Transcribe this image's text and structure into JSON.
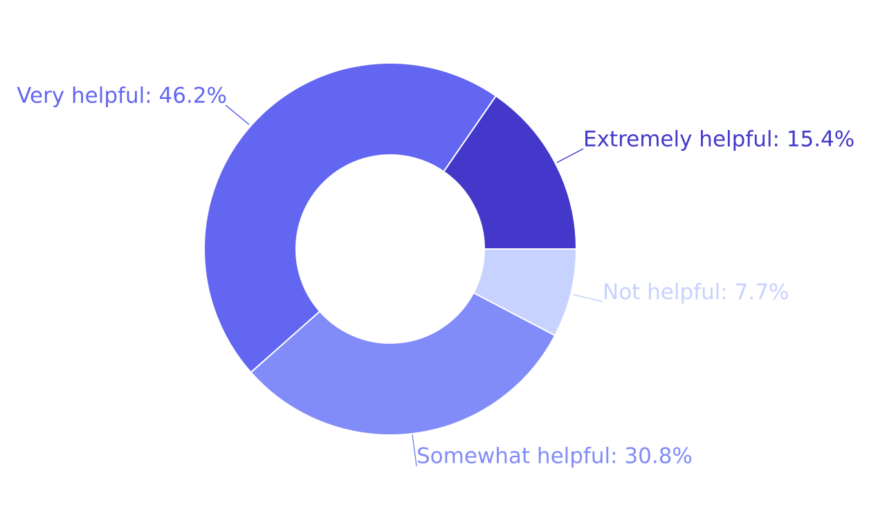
{
  "chart_data": {
    "type": "pie",
    "hole": true,
    "legend": "none",
    "slices": [
      {
        "label": "Extremely helpful",
        "value": 15.4,
        "display": "Extremely helpful: 15.4%",
        "color": "#4338ca"
      },
      {
        "label": "Very helpful",
        "value": 46.2,
        "display": "Very helpful: 46.2%",
        "color": "#6366f1"
      },
      {
        "label": "Somewhat helpful",
        "value": 30.8,
        "display": "Somewhat helpful: 30.8%",
        "color": "#818cf8"
      },
      {
        "label": "Not helpful",
        "value": 7.7,
        "display": "Not helpful: 7.7%",
        "color": "#c7d2fe"
      }
    ]
  }
}
